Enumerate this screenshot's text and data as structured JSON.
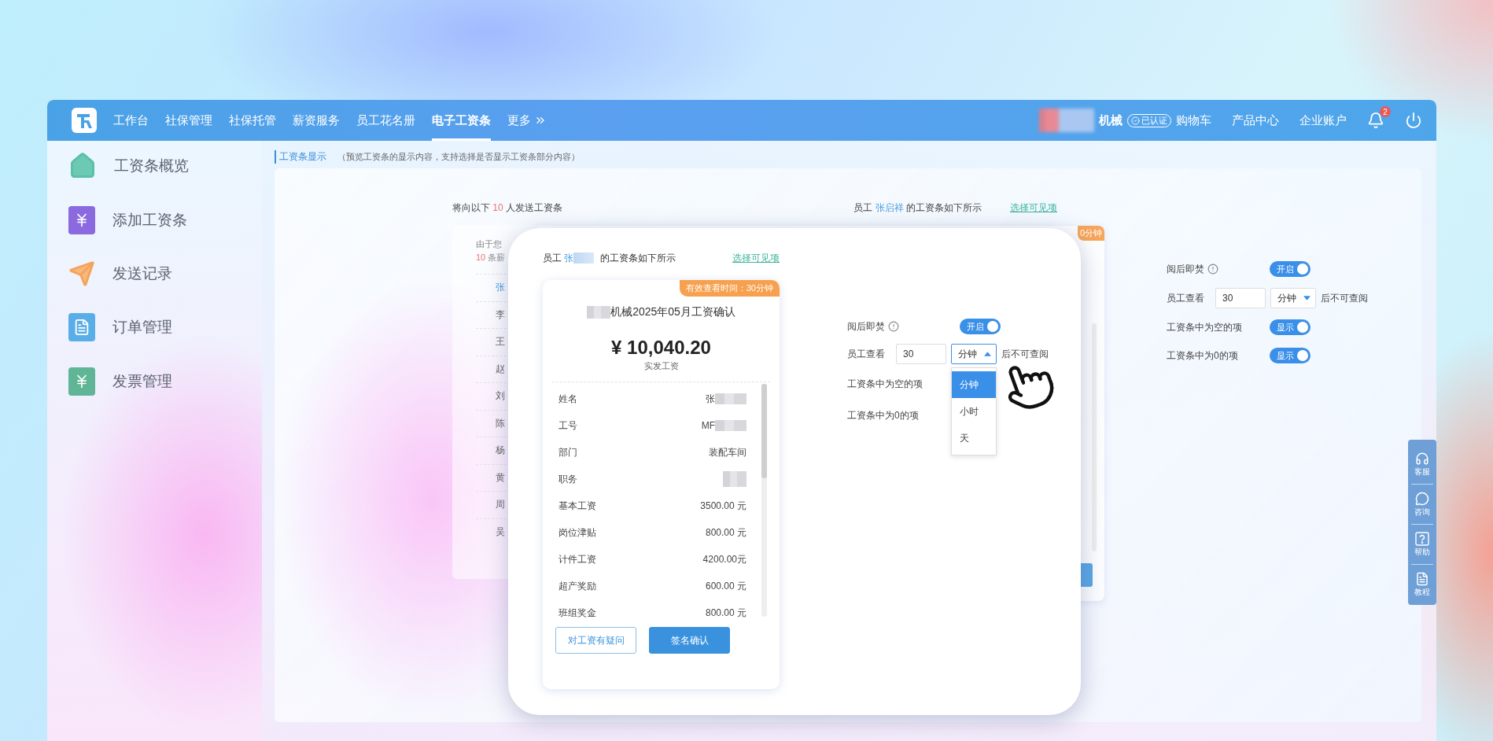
{
  "nav": {
    "items": [
      {
        "label": "工作台",
        "selected": false
      },
      {
        "label": "社保管理",
        "selected": false
      },
      {
        "label": "社保托管",
        "selected": false
      },
      {
        "label": "薪资服务",
        "selected": false
      },
      {
        "label": "员工花名册",
        "selected": false
      },
      {
        "label": "电子工资条",
        "selected": true
      },
      {
        "label": "更多",
        "selected": false
      }
    ],
    "company": "机械",
    "verified": "已认证",
    "links": [
      "购物车",
      "产品中心",
      "企业账户"
    ],
    "notifications": "2"
  },
  "sidebar": {
    "items": [
      {
        "label": "工资条概览",
        "kind": "home"
      },
      {
        "label": "添加工资条",
        "kind": "add"
      },
      {
        "label": "发送记录",
        "kind": "send"
      },
      {
        "label": "订单管理",
        "kind": "order"
      },
      {
        "label": "发票管理",
        "kind": "invoice"
      }
    ]
  },
  "section": {
    "title": "工资条显示",
    "note": "（预览工资条的显示内容，支持选择是否显示工资条部分内容）"
  },
  "recipients": {
    "prefix": "将向以下",
    "count": "10",
    "suffix": "人发送工资条",
    "notice": "由于您",
    "notice_count": "10",
    "notice_rest": "条薪",
    "people": [
      {
        "name": "张",
        "selected": true
      },
      {
        "name": "李",
        "selected": false
      },
      {
        "name": "王",
        "selected": false
      },
      {
        "name": "赵",
        "selected": false
      },
      {
        "name": "刘",
        "selected": false
      },
      {
        "name": "陈",
        "selected": false
      },
      {
        "name": "杨",
        "selected": false
      },
      {
        "name": "黄",
        "selected": false
      },
      {
        "name": "周",
        "selected": false
      },
      {
        "name": "吴",
        "selected": false
      }
    ]
  },
  "preview": {
    "prefix": "员工",
    "name": "张启祥",
    "suffix": "的工资条如下所示",
    "link": "选择可见项",
    "tag": "0分钟"
  },
  "settings": [
    {
      "kind": "toggle",
      "label": "阅后即焚",
      "info": true,
      "toggle": {
        "label": "开启",
        "on": true
      }
    },
    {
      "kind": "duration",
      "label": "员工查看",
      "value": "30",
      "unit": "分钟",
      "suffix": "后不可查阅",
      "open": false
    },
    {
      "kind": "toggle",
      "label": "工资条中为空的项",
      "info": false,
      "toggle": {
        "label": "显示",
        "on": true
      }
    },
    {
      "kind": "toggle",
      "label": "工资条中为0的项",
      "info": false,
      "toggle": {
        "label": "显示",
        "on": true
      }
    }
  ],
  "popup": {
    "prefix": "员工",
    "name": "张",
    "name_redacted": true,
    "suffix": "的工资条如下所示",
    "link": "选择可见项",
    "slip": {
      "tag": "有效查看时间：30分钟",
      "title": "机械2025年05月工资确认",
      "title_redacted": true,
      "amount": "¥ 10,040.20",
      "amount_label": "实发工资",
      "rows": [
        {
          "label": "姓名",
          "value": "张",
          "redacted": true
        },
        {
          "label": "工号",
          "value": "MF",
          "redacted": true
        },
        {
          "label": "部门",
          "value": "装配车间",
          "redacted": false
        },
        {
          "label": "职务",
          "redacted": true
        },
        {
          "label": "基本工资",
          "value": "3500.00 元",
          "redacted": false
        },
        {
          "label": "岗位津贴",
          "value": "800.00 元",
          "redacted": false
        },
        {
          "label": "计件工资",
          "value": "4200.00元",
          "redacted": false
        },
        {
          "label": "超产奖励",
          "value": "600.00 元",
          "redacted": false
        },
        {
          "label": "班组奖金",
          "value": "800.00 元",
          "redacted": false
        }
      ],
      "buttons": [
        {
          "label": "对工资有疑问",
          "kind": "outline"
        },
        {
          "label": "签名确认",
          "kind": "primary"
        }
      ]
    },
    "settings": [
      {
        "kind": "toggle",
        "label": "阅后即焚",
        "info": true,
        "toggle": {
          "label": "开启",
          "on": true
        }
      },
      {
        "kind": "duration",
        "label": "员工查看",
        "value": "30",
        "unit": "分钟",
        "suffix": "后不可查阅",
        "open": true,
        "options": [
          {
            "label": "分钟",
            "selected": true
          },
          {
            "label": "小时",
            "selected": false
          },
          {
            "label": "天",
            "selected": false
          }
        ]
      },
      {
        "kind": "label",
        "label": "工资条中为空的项"
      },
      {
        "kind": "label",
        "label": "工资条中为0的项"
      }
    ]
  },
  "side_tools": [
    {
      "label": "客服",
      "kind": "headset"
    },
    {
      "label": "咨询",
      "kind": "chat"
    },
    {
      "label": "帮助",
      "kind": "help"
    },
    {
      "label": "教程",
      "kind": "guide"
    }
  ]
}
